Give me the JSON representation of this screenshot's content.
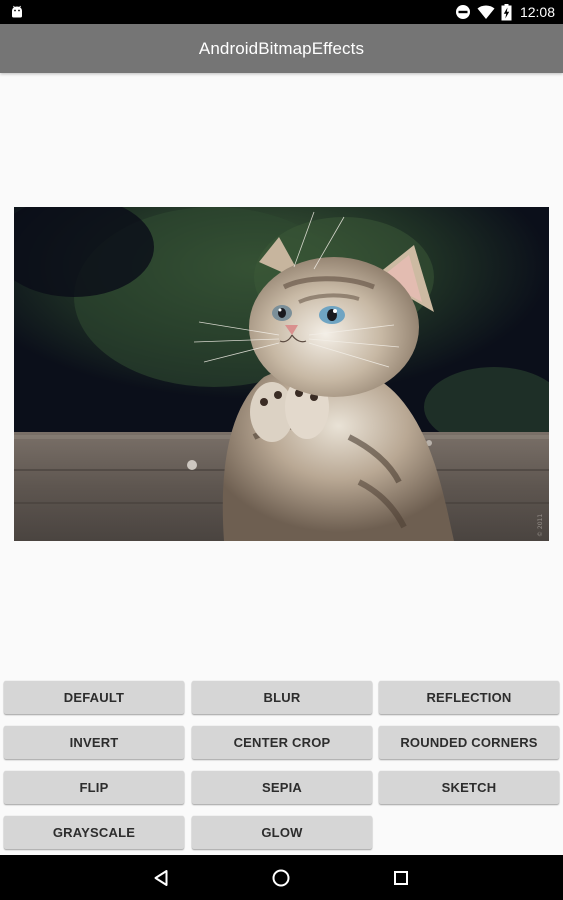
{
  "status_bar": {
    "time": "12:08",
    "icons": [
      "android-debug-icon",
      "do-not-disturb-icon",
      "wifi-icon",
      "battery-charging-icon"
    ]
  },
  "app_bar": {
    "title": "AndroidBitmapEffects"
  },
  "image": {
    "subject": "kitten-praying-photo"
  },
  "buttons": [
    {
      "label": "DEFAULT"
    },
    {
      "label": "BLUR"
    },
    {
      "label": "REFLECTION"
    },
    {
      "label": "INVERT"
    },
    {
      "label": "CENTER CROP"
    },
    {
      "label": "ROUNDED CORNERS"
    },
    {
      "label": "FLIP"
    },
    {
      "label": "SEPIA"
    },
    {
      "label": "SKETCH"
    },
    {
      "label": "GRAYSCALE"
    },
    {
      "label": "GLOW"
    }
  ],
  "nav_bar": {
    "icons": [
      "back-icon",
      "home-icon",
      "recents-icon"
    ]
  },
  "colors": {
    "status_bar": "#000000",
    "app_bar": "#757575",
    "background": "#fafafa",
    "button": "#d6d6d6",
    "nav_bar": "#000000"
  }
}
